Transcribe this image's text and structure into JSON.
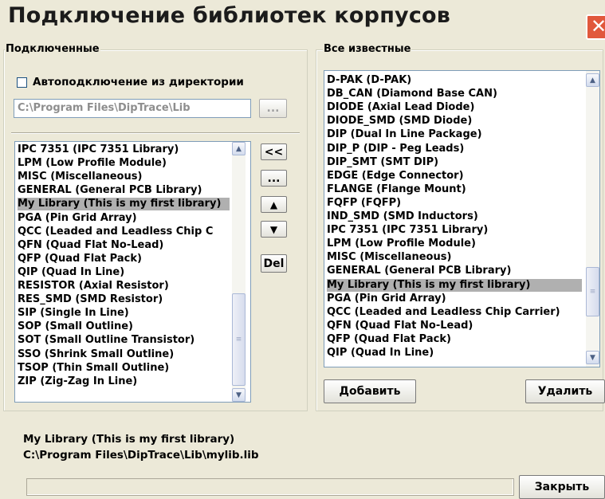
{
  "window": {
    "title": "Подключение библиотек корпусов"
  },
  "left": {
    "group_label": "Подключенные",
    "autoconnect_label": "Автоподключение из директории",
    "autoconnect_checked": false,
    "path_value": "C:\\Program Files\\DipTrace\\Lib",
    "browse_label": "...",
    "items": [
      "IPC 7351 (IPC 7351 Library)",
      "LPM (Low Profile Module)",
      "MISC (Miscellaneous)",
      "GENERAL (General PCB Library)",
      "My Library (This is my first library)",
      "PGA (Pin Grid Array)",
      "QCC (Leaded and Leadless Chip C",
      "QFN (Quad Flat No-Lead)",
      "QFP (Quad Flat Pack)",
      "QIP (Quad In Line)",
      "RESISTOR (Axial Resistor)",
      "RES_SMD (SMD Resistor)",
      "SIP (Single In Line)",
      "SOP (Small Outline)",
      "SOT (Small Outline Transistor)",
      "SSO (Shrink Small Outline)",
      "TSOP (Thin Small Outline)",
      "ZIP (Zig-Zag In Line)"
    ],
    "selected_index": 4
  },
  "middle_buttons": {
    "add_left": "<<",
    "browse": "...",
    "move_up": "▲",
    "move_down": "▼",
    "delete": "Del"
  },
  "right": {
    "group_label": "Все известные",
    "items": [
      "D-PAK (D-PAK)",
      "DB_CAN (Diamond Base CAN)",
      "DIODE (Axial Lead Diode)",
      "DIODE_SMD (SMD Diode)",
      "DIP (Dual In Line Package)",
      "DIP_P (DIP - Peg Leads)",
      "DIP_SMT (SMT DIP)",
      "EDGE (Edge Connector)",
      "FLANGE (Flange Mount)",
      "FQFP (FQFP)",
      "IND_SMD (SMD Inductors)",
      "IPC 7351 (IPC 7351 Library)",
      "LPM (Low Profile Module)",
      "MISC (Miscellaneous)",
      "GENERAL (General PCB Library)",
      "My Library (This is my first library)",
      "PGA (Pin Grid Array)",
      "QCC (Leaded and Leadless Chip Carrier)",
      "QFN (Quad Flat No-Lead)",
      "QFP (Quad Flat Pack)",
      "QIP (Quad In Line)"
    ],
    "selected_index": 15,
    "add_label": "Добавить",
    "remove_label": "Удалить"
  },
  "info": {
    "name": "My Library (This is my first library)",
    "path": "C:\\Program Files\\DipTrace\\Lib\\mylib.lib"
  },
  "footer": {
    "close_label": "Закрыть"
  },
  "icons": {
    "close": "close-icon",
    "scroll_up": "scroll-up-icon",
    "scroll_down": "scroll-down-icon",
    "checkbox": "checkbox-icon"
  },
  "colors": {
    "background": "#ece9d8",
    "selection": "#b0b0b0",
    "close_button": "#e1583c",
    "field_border": "#7f9db9"
  }
}
